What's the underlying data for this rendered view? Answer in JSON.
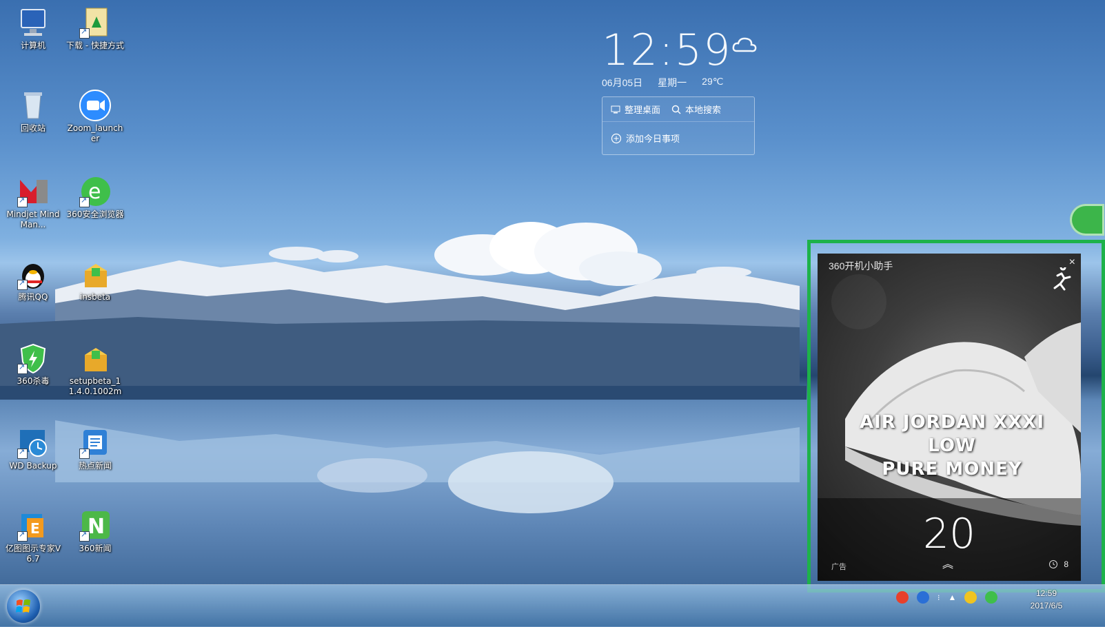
{
  "desktop_icons": [
    {
      "name": "computer",
      "label": "计算机"
    },
    {
      "name": "downloads-shortcut",
      "label": "下载 - 快捷方式"
    },
    {
      "name": "recycle-bin",
      "label": "回收站"
    },
    {
      "name": "zoom-launcher",
      "label": "Zoom_launcher"
    },
    {
      "name": "mindjet",
      "label": "Mindjet MindMan..."
    },
    {
      "name": "360-browser",
      "label": "360安全浏览器"
    },
    {
      "name": "qq",
      "label": "腾讯QQ"
    },
    {
      "name": "insbeta",
      "label": "insbeta"
    },
    {
      "name": "360-antivirus",
      "label": "360杀毒"
    },
    {
      "name": "setupbeta",
      "label": "setupbeta_11.4.0.1002m"
    },
    {
      "name": "wd-backup",
      "label": "WD Backup"
    },
    {
      "name": "hot-news",
      "label": "热点新闻"
    },
    {
      "name": "edraw",
      "label": "亿图图示专家V6.7"
    },
    {
      "name": "360-news",
      "label": "360新闻"
    }
  ],
  "clock_widget": {
    "time": "12:59",
    "date": "06月05日",
    "weekday": "星期一",
    "temperature": "29℃",
    "organize_desktop": "整理桌面",
    "local_search": "本地搜索",
    "add_today_item": "添加今日事项"
  },
  "popup": {
    "title": "360开机小助手",
    "close": "×",
    "ad_line1": "AIR JORDAN XXXI LOW",
    "ad_line2": "PURE MONEY",
    "countdown": "20",
    "ad_tag": "广告",
    "views": "8"
  },
  "taskbar": {
    "clock_time": "12:59",
    "clock_date": "2017/6/5",
    "colors": {
      "popup_border": "#1db24a"
    }
  }
}
